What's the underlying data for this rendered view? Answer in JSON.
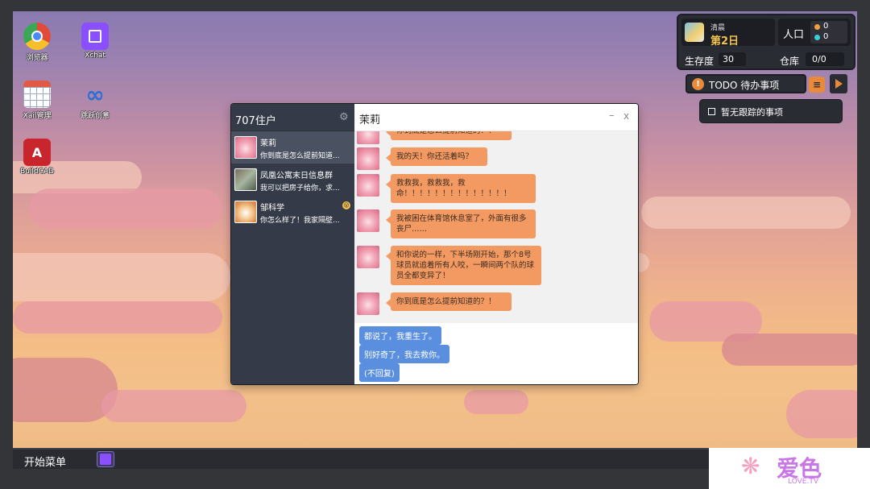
{
  "desktop": {
    "icons": [
      {
        "label": "浏览器",
        "icon": "chrome-icon",
        "color": "#e04b3a"
      },
      {
        "label": "Xchat",
        "icon": "twitch-icon",
        "color": "#8a4fff"
      },
      {
        "label": "Xail管理",
        "icon": "calendar-grid-icon",
        "color": "#e05a46"
      },
      {
        "label": "跳跃创意",
        "icon": "infinity-icon",
        "color": "#2b6fd8"
      },
      {
        "label": "BuildCAD",
        "icon": "autocad-icon",
        "color": "#c8252c"
      }
    ]
  },
  "hud": {
    "time": "清晨",
    "day": "第2日",
    "population_label": "人口",
    "pop_orange": "0",
    "pop_cyan": "0",
    "survival_label": "生存度",
    "survival_value": "30",
    "storage_label": "仓库",
    "storage_value": "0/0"
  },
  "todo": {
    "warn_glyph": "!",
    "title": "TODO 待办事项",
    "menu_glyph": "≡",
    "empty_text": "暂无跟踪的事项"
  },
  "chat": {
    "app_title": "707住户",
    "gear_glyph": "⚙",
    "contacts": [
      {
        "name": "茉莉",
        "preview": "你到底是怎么提前知道...",
        "avatar": "pink-hair-avatar"
      },
      {
        "name": "凤凰公寓末日信息群",
        "preview": "我可以把房子给你，求...",
        "avatar": "group-avatar"
      },
      {
        "name": "邹科学",
        "preview": "你怎么样了！我家隔壁...",
        "avatar": "dog-avatar",
        "badge": "😮"
      }
    ],
    "active_title": "茉莉",
    "min_glyph": "–",
    "close_glyph": "x",
    "messages": [
      "你到底是怎么提前知道的？！",
      "我的天！你还活着吗？",
      "救救我，救救我，救命！！！！！！！！！！！！！！",
      "我被困在体育馆休息室了，外面有很多丧尸……",
      "和你说的一样，下半场刚开始，那个8号球员就追着所有人咬，一瞬间两个队的球员全都变异了！",
      "你到底是怎么提前知道的？！"
    ],
    "replies": [
      "都说了，我重生了。",
      "别好奇了，我去救你。",
      "(不回复)"
    ]
  },
  "taskbar": {
    "start_label": "开始菜单"
  },
  "watermark": {
    "glyph": "❋",
    "text": "爱色",
    "sub": "LOVE.TV"
  }
}
